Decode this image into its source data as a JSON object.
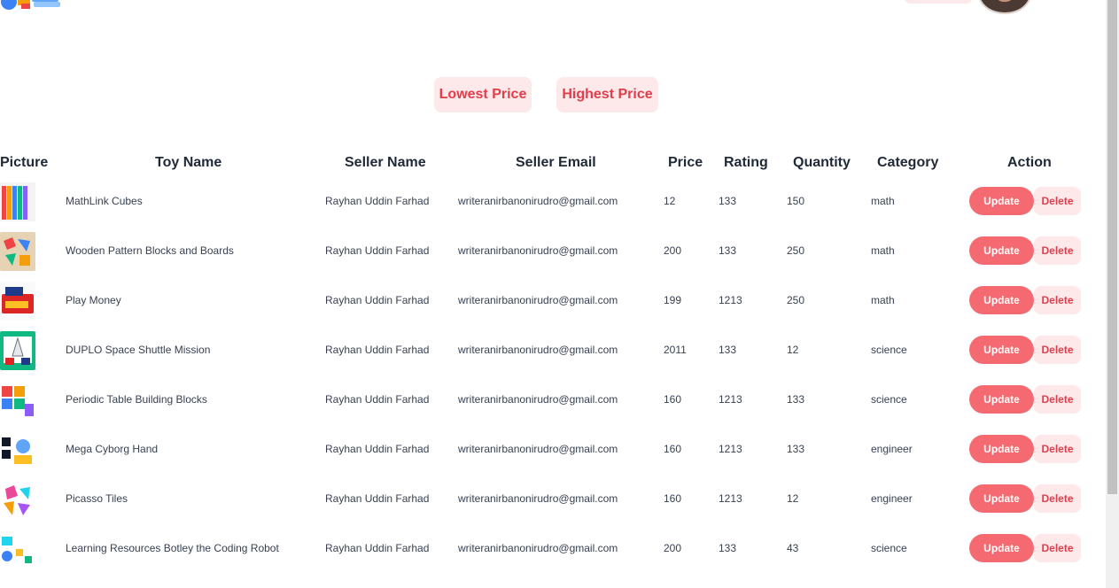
{
  "sort": {
    "low_label": "Lowest Price",
    "high_label": "Highest Price"
  },
  "table": {
    "headers": [
      "Picture",
      "Toy Name",
      "Seller Name",
      "Seller Email",
      "Price",
      "Rating",
      "Quantity",
      "Category",
      "Action"
    ],
    "update_label": "Update",
    "delete_label": "Delete",
    "rows": [
      {
        "toy": "MathLink Cubes",
        "seller": "Rayhan Uddin Farhad",
        "email": "writeranirbanonirudro@gmail.com",
        "price": "12",
        "rating": "133",
        "quantity": "150",
        "category": "math"
      },
      {
        "toy": "Wooden Pattern Blocks and Boards",
        "seller": "Rayhan Uddin Farhad",
        "email": "writeranirbanonirudro@gmail.com",
        "price": "200",
        "rating": "133",
        "quantity": "250",
        "category": "math"
      },
      {
        "toy": "Play Money",
        "seller": "Rayhan Uddin Farhad",
        "email": "writeranirbanonirudro@gmail.com",
        "price": "199",
        "rating": "1213",
        "quantity": "250",
        "category": "math"
      },
      {
        "toy": "DUPLO Space Shuttle Mission",
        "seller": "Rayhan Uddin Farhad",
        "email": "writeranirbanonirudro@gmail.com",
        "price": "2011",
        "rating": "133",
        "quantity": "12",
        "category": "science"
      },
      {
        "toy": "Periodic Table Building Blocks",
        "seller": "Rayhan Uddin Farhad",
        "email": "writeranirbanonirudro@gmail.com",
        "price": "160",
        "rating": "1213",
        "quantity": "133",
        "category": "science"
      },
      {
        "toy": "Mega Cyborg Hand",
        "seller": "Rayhan Uddin Farhad",
        "email": "writeranirbanonirudro@gmail.com",
        "price": "160",
        "rating": "1213",
        "quantity": "133",
        "category": "engineer"
      },
      {
        "toy": "Picasso Tiles",
        "seller": "Rayhan Uddin Farhad",
        "email": "writeranirbanonirudro@gmail.com",
        "price": "160",
        "rating": "1213",
        "quantity": "12",
        "category": "engineer"
      },
      {
        "toy": "Learning Resources Botley the Coding Robot",
        "seller": "Rayhan Uddin Farhad",
        "email": "writeranirbanonirudro@gmail.com",
        "price": "200",
        "rating": "133",
        "quantity": "43",
        "category": "science"
      }
    ]
  },
  "colors": {
    "accent": "#e23d4b",
    "pill_bg": "#fde8ea",
    "update_bg": "#f46a70"
  },
  "icons": {
    "logo": "toy-logo-icon",
    "avatar": "user-avatar"
  }
}
